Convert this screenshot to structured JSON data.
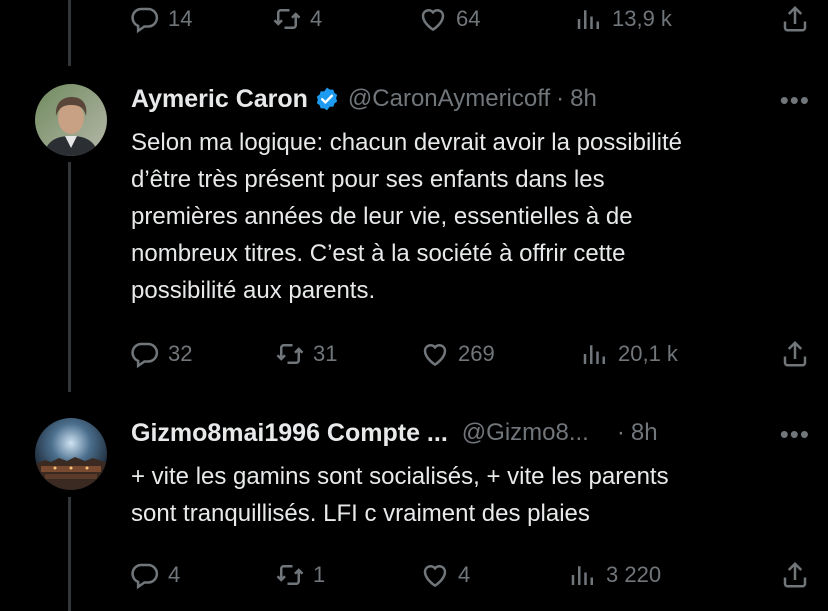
{
  "tweet_top": {
    "replies": "14",
    "retweets": "4",
    "likes": "64",
    "views": "13,9 k"
  },
  "tweet_caron": {
    "name": "Aymeric Caron",
    "handle": "@CaronAymericoff",
    "separator": "·",
    "time": "8h",
    "more": "•••",
    "text_lines": [
      "Selon ma logique: chacun devrait avoir la possibilité",
      "d’être très présent pour ses enfants dans les",
      "premières années de leur vie, essentielles à de",
      "nombreux titres. C’est à la société à offrir cette",
      "possibilité aux parents."
    ],
    "replies": "32",
    "retweets": "31",
    "likes": "269",
    "views": "20,1 k"
  },
  "tweet_gizmo": {
    "name": "Gizmo8mai1996 Compte ...",
    "handle": "@Gizmo8...",
    "separator": "·",
    "time": "8h",
    "more": "•••",
    "text_lines": [
      "+ vite les gamins sont socialisés, + vite les parents",
      "sont tranquillisés. LFI c vraiment des plaies"
    ],
    "replies": "4",
    "retweets": "1",
    "likes": "4",
    "views": "3 220"
  },
  "colors": {
    "background": "#000000",
    "text": "#e7e9ea",
    "muted": "#71767b",
    "thread_line": "#333639",
    "verified": "#1d9bf0"
  },
  "icons": [
    "reply-icon",
    "retweet-icon",
    "like-icon",
    "views-icon",
    "share-icon",
    "verified-badge-icon",
    "more-icon"
  ]
}
